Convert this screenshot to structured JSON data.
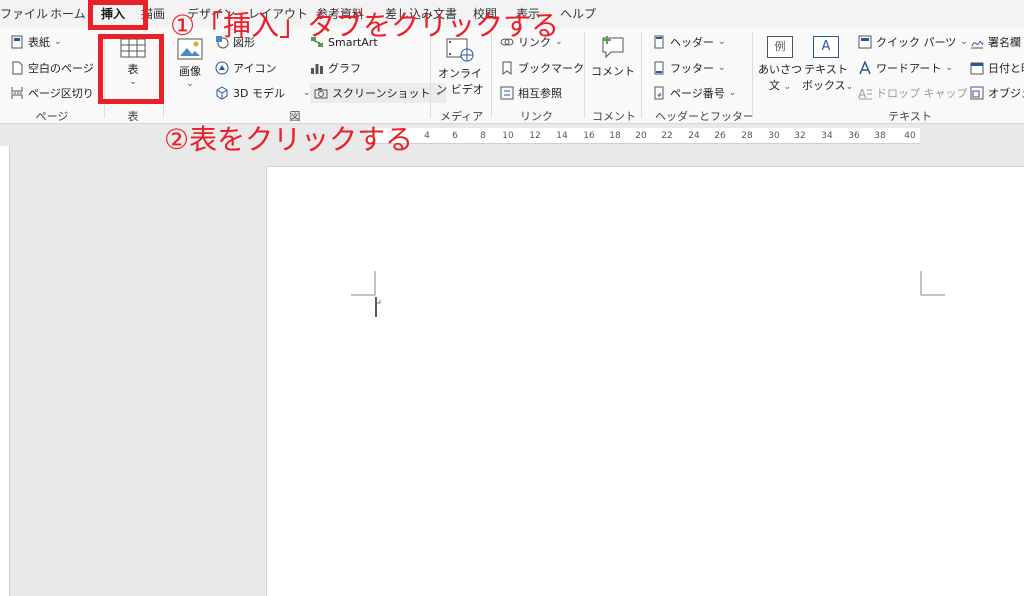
{
  "tabs": [
    "ファイル",
    "ホーム",
    "挿入",
    "描画",
    "デザイン",
    "レイアウト",
    "参考資料",
    "差し込み文書",
    "校閲",
    "表示",
    "ヘルプ"
  ],
  "active_tab": "挿入",
  "ribbon": {
    "pages": {
      "label": "ページ",
      "cover": "表紙",
      "blank": "空白のページ",
      "break": "ページ区切り"
    },
    "table": {
      "label": "表",
      "table_button": "表"
    },
    "illustrations": {
      "label": "図",
      "picture": "画像",
      "shapes": "図形",
      "icons": "アイコン",
      "model3d": "3D モデル",
      "smartart": "SmartArt",
      "chart": "グラフ",
      "screenshot": "スクリーンショット"
    },
    "media": {
      "label": "メディア",
      "online_video_1": "オンライ",
      "online_video_2": "ン ビデオ"
    },
    "links": {
      "label": "リンク",
      "link": "リンク",
      "bookmark": "ブックマーク",
      "crossref": "相互参照"
    },
    "comments": {
      "label": "コメント",
      "comment": "コメント"
    },
    "header_footer": {
      "label": "ヘッダーとフッター",
      "header": "ヘッダー",
      "footer": "フッター",
      "page_number": "ページ番号"
    },
    "text": {
      "label": "テキスト",
      "greeting_1": "あいさつ",
      "greeting_2": "文",
      "textbox_1": "テキスト",
      "textbox_2": "ボックス",
      "quickparts": "クイック パーツ",
      "wordart": "ワードアート",
      "dropcap": "ドロップ キャップ",
      "signature": "署名欄",
      "datetime": "日付と時",
      "object": "オブジェク",
      "greeting_icon": "例",
      "textbox_icon": "A"
    }
  },
  "ruler_ticks": [
    "4",
    "6",
    "8",
    "10",
    "12",
    "14",
    "16",
    "18",
    "20",
    "22",
    "24",
    "26",
    "28",
    "30",
    "32",
    "34",
    "36",
    "38",
    "40"
  ],
  "annotations": {
    "step1": "①「挿入」タブをクリックする",
    "step2": "②表をクリックする"
  },
  "colors": {
    "annotation": "#e8202a",
    "accent": "#2b579a"
  }
}
